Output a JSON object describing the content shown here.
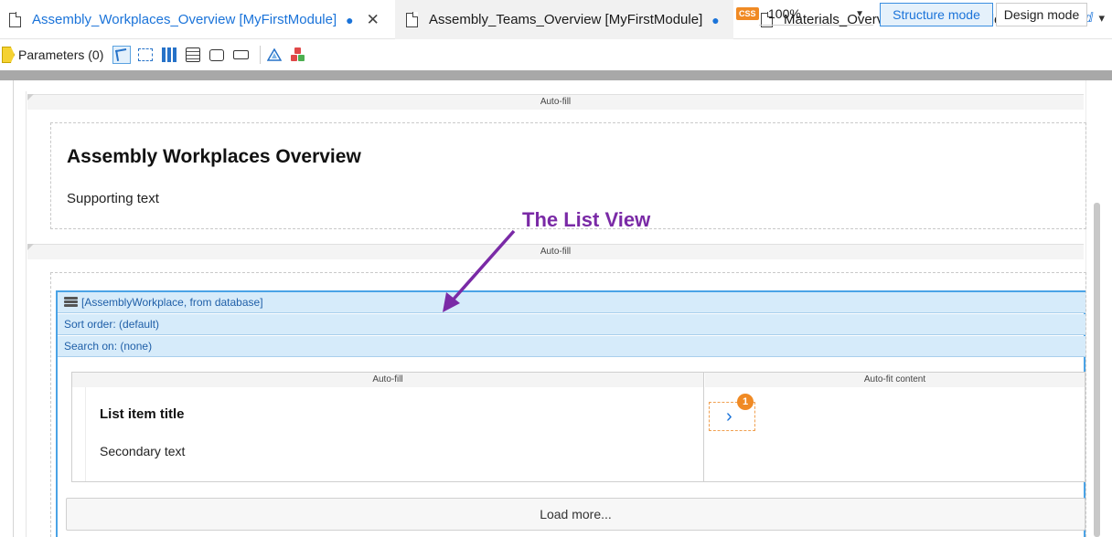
{
  "tabs": [
    {
      "title": "Assembly_Workplaces_Overview [MyFirstModule]",
      "dot": "●",
      "close": "✕"
    },
    {
      "title": "Assembly_Teams_Overview [MyFirstModule]",
      "dot": "●"
    },
    {
      "title": "Materials_Overview [MyFirstModule]",
      "dot": "●"
    }
  ],
  "toolbar": {
    "parameters_label": "Parameters (0)",
    "css_badge": "CSS",
    "zoom_value": "100%",
    "structure_mode": "Structure mode",
    "design_mode": "Design mode"
  },
  "canvas": {
    "autofill_1": "Auto-fill",
    "autofill_2": "Auto-fill",
    "page_title": "Assembly Workplaces Overview",
    "supporting_text": "Supporting text",
    "listview": {
      "datasource": "[AssemblyWorkplace, from database]",
      "sort_order": "Sort order: (default)",
      "search_on": "Search on: (none)",
      "col1_header": "Auto-fill",
      "col2_header": "Auto-fit content",
      "item_title": "List item title",
      "item_secondary": "Secondary text",
      "chevron": "›",
      "badge": "1",
      "load_more": "Load more..."
    }
  },
  "annotation": {
    "label": "The List View",
    "color": "#7a2aa6"
  },
  "colors": {
    "accent": "#1a73d9",
    "listview_bg": "#d6ebfa",
    "listview_border": "#4aa3e6",
    "badge": "#f08a24"
  }
}
